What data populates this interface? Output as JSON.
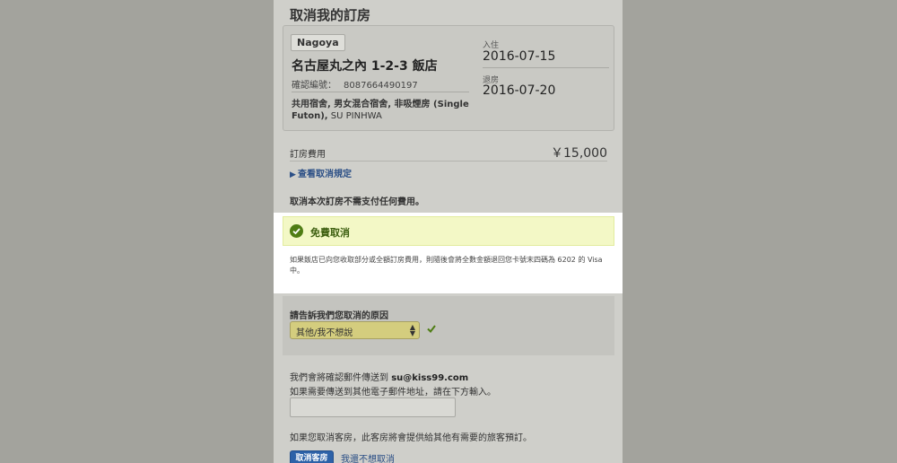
{
  "title": "取消我的訂房",
  "booking": {
    "city": "Nagoya",
    "hotel_name": "名古屋丸之內 1-2-3 飯店",
    "confirmation_label": "確認編號：",
    "confirmation_number": "8087664490197",
    "room_description": "共用宿舍, 男女混合宿舍, 非吸煙房 (Single Futon),",
    "guest_name": " SU PINHWA",
    "checkin_label": "入住",
    "checkin_date": "2016-07-15",
    "checkout_label": "退房",
    "checkout_date": "2016-07-20"
  },
  "fee": {
    "label": "訂房費用",
    "value": "￥15,000"
  },
  "policy_link": "查看取消規定",
  "no_fee_text": "取消本次訂房不需支付任何費用。",
  "free_cancel": {
    "label": "免費取消",
    "note": "如果飯店已向您收取部分或全額訂房費用，則隨後會將全數金額退回您卡號末四碼為 6202 的 Visa 中。"
  },
  "reason": {
    "label": "請告訴我們您取消的原因",
    "selected": "其他/我不想說"
  },
  "email": {
    "prefix": "我們會將確認郵件傳送到 ",
    "address": "su@kiss99.com",
    "other_note": "如果需要傳送到其他電子郵件地址，請在下方輸入。",
    "input_value": ""
  },
  "offer_note": "如果您取消客房，此客房將會提供給其他有需要的旅客預訂。",
  "buttons": {
    "cancel": "取消客房",
    "keep": "我還不想取消"
  },
  "colors": {
    "accent_blue": "#2d62a8",
    "success_green": "#4f7d14",
    "highlight_bg": "#f3f8c6"
  }
}
